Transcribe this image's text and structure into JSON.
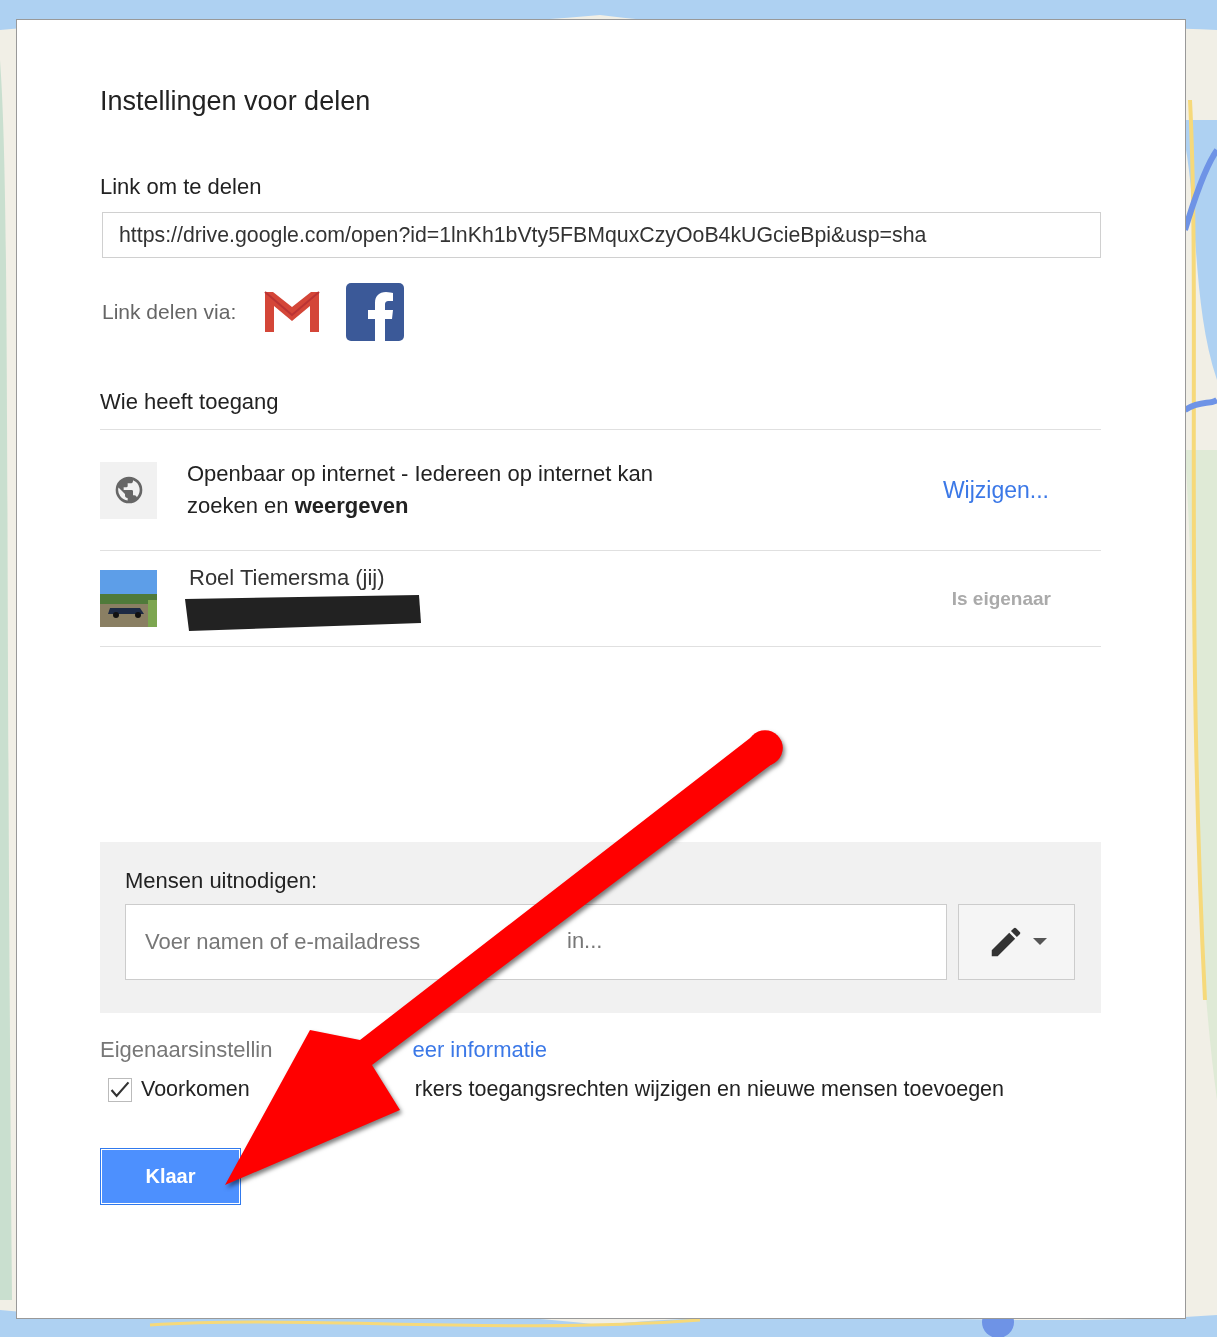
{
  "dialog": {
    "title": "Instellingen voor delen",
    "link_label": "Link om te delen",
    "link_value": "https://drive.google.com/open?id=1lnKh1bVty5FBMquxCzyOoB4kUGcieBpi&usp=sha",
    "share_via_label": "Link delen via:",
    "access_heading": "Wie heeft toegang",
    "access": [
      {
        "kind": "visibility",
        "text": "Openbaar op internet - Iedereen op internet kan zoeken en **weergeven**",
        "action": "Wijzigen..."
      },
      {
        "kind": "person",
        "name": "Roel Tiemersma (jij)",
        "role": "Is eigenaar",
        "email_redacted": true
      }
    ],
    "invite": {
      "label": "Mensen uitnodigen:",
      "placeholder": "Voer namen of e-mailadress",
      "placeholder_tail": "in..."
    },
    "owner_settings": {
      "label": "Eigenaarsinstellin",
      "link": "eer informatie"
    },
    "option": {
      "checked": true,
      "label_start": "Voorkomen",
      "label_end": "rkers toegangsrechten wijzigen en nieuwe mensen toevoegen"
    },
    "done_button": "Klaar"
  },
  "annotation": {
    "kind": "arrow"
  }
}
